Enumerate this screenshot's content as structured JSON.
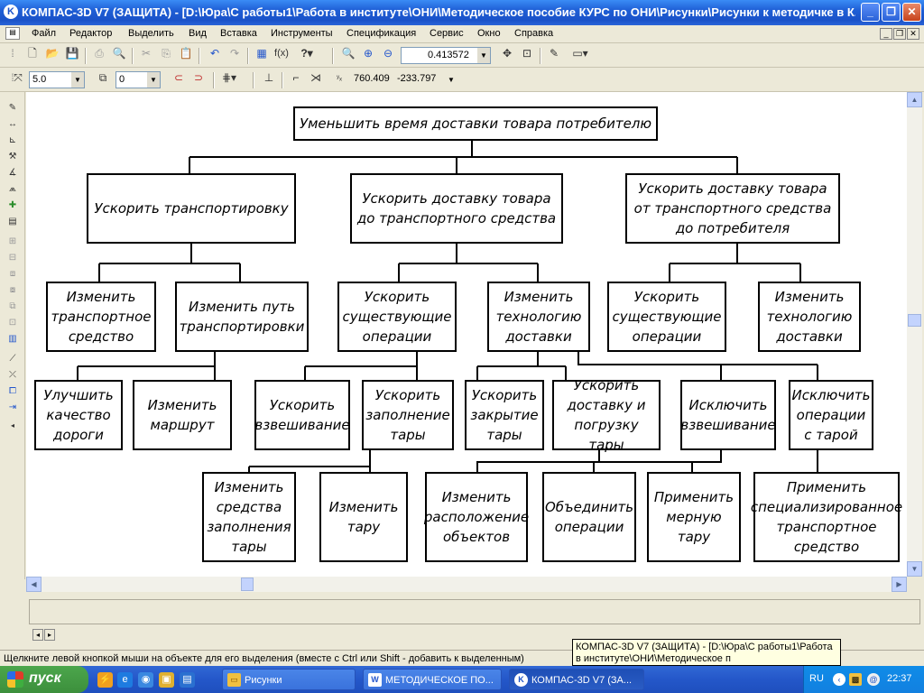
{
  "window": {
    "title": "КОМПАС-3D V7 (ЗАЩИТА) - [D:\\Юра\\С работы1\\Работа в институте\\ОНИ\\Методическое пособие КУРС по ОНИ\\Рисунки\\Рисунки к методичке в К..."
  },
  "menu": [
    "Файл",
    "Редактор",
    "Выделить",
    "Вид",
    "Вставка",
    "Инструменты",
    "Спецификация",
    "Сервис",
    "Окно",
    "Справка"
  ],
  "toolbar1": {
    "zoom": "0.413572"
  },
  "toolbar2": {
    "step": "5.0",
    "layer": "0",
    "coord_x": "760.409",
    "coord_y": "-233.797"
  },
  "diagram": {
    "root": "Уменьшить время доставки товара потребителю",
    "n1": "Ускорить транспортировку",
    "n2": "Ускорить доставку товара до транспортного средства",
    "n3": "Ускорить доставку товара от транспортного средства до потребителя",
    "n11": "Изменить транспортное средство",
    "n12": "Изменить путь транспортировки",
    "n21": "Ускорить существующие операции",
    "n22": "Изменить технологию доставки",
    "n31": "Ускорить существующие операции",
    "n32": "Изменить технологию доставки",
    "l1": "Улучшить качество дороги",
    "l2": "Изменить маршрут",
    "l3": "Ускорить взвешивание",
    "l4": "Ускорить заполнение тары",
    "l5": "Ускорить закрытие тары",
    "l6": "Ускорить доставку и погрузку тары",
    "l7": "Исключить взвешивание",
    "l8": "Исключить операции с тарой",
    "b1": "Изменить средства заполнения тары",
    "b2": "Изменить тару",
    "b3": "Изменить расположение объектов",
    "b4": "Объединить операции",
    "b5": "Применить мерную тару",
    "b6": "Применить специализированное транспортное средство"
  },
  "status": {
    "hint": "Щелкните левой кнопкой мыши на объекте для его выделения (вместе с Ctrl или Shift - добавить к выделенным)"
  },
  "tooltip": {
    "text": "КОМПАС-3D V7 (ЗАЩИТА) - [D:\\Юра\\С работы1\\Работа в институте\\ОНИ\\Методическое п"
  },
  "taskbar": {
    "start": "пуск",
    "tasks": [
      "Рисунки",
      "МЕТОДИЧЕСКОЕ ПО...",
      "КОМПАС-3D V7 (ЗА..."
    ],
    "lang": "RU",
    "clock": "22:37"
  }
}
